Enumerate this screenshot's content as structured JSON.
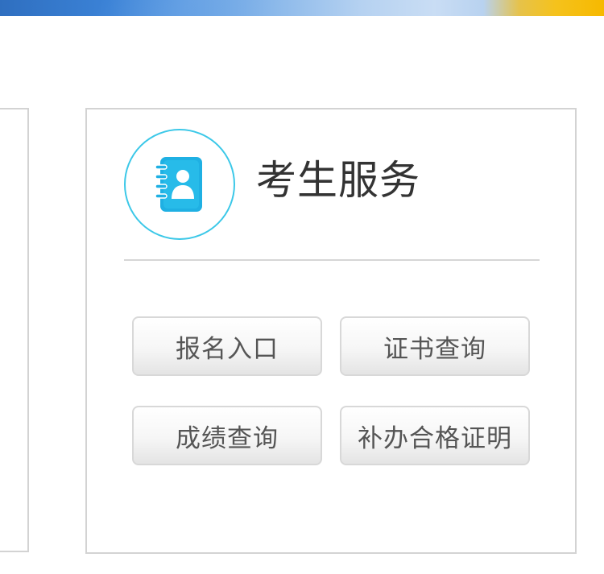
{
  "service": {
    "title": "考生服务",
    "icon": "contact-book-icon",
    "accent_color": "#3cc8e8",
    "icon_color": "#1fb0e3"
  },
  "buttons": [
    {
      "label": "报名入口"
    },
    {
      "label": "证书查询"
    },
    {
      "label": "成绩查询"
    },
    {
      "label": "补办合格证明"
    }
  ],
  "colors": {
    "border": "#d3d3d3",
    "text": "#333333",
    "button_text": "#555555"
  }
}
